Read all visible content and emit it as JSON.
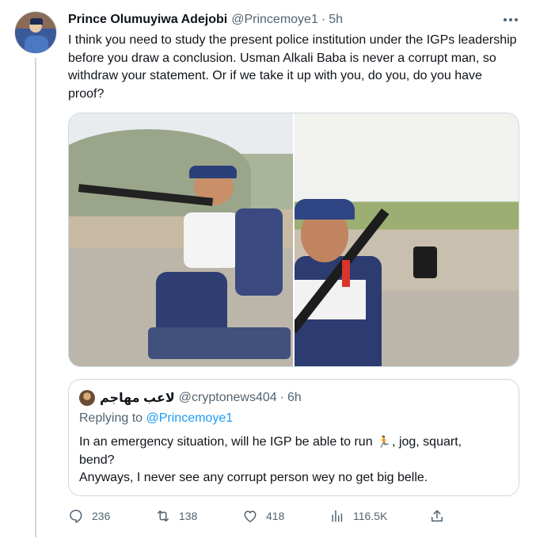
{
  "tweet": {
    "display_name": "Prince Olumuyiwa Adejobi",
    "handle": "@Princemoye1",
    "separator": "·",
    "time": "5h",
    "text": "I think you need to study the present police institution under the IGPs leadership before you draw a conclusion. Usman Alkali Baba is never a corrupt man, so withdraw your statement. Or if we take it up with you, do you, do you have proof?",
    "avatar_icon": "profile-avatar",
    "more_icon": "more-horizontal-icon"
  },
  "media": {
    "photos": [
      {
        "subject": "officer-kneeling-firing-rifle"
      },
      {
        "subject": "officer-holding-rifle"
      }
    ]
  },
  "quote": {
    "display_name": "لاعب مهاجم",
    "handle": "@cryptonews404",
    "separator": "·",
    "time": "6h",
    "replying_prefix": "Replying to",
    "replying_mention": "@Princemoye1",
    "text_line1_before": "In an emergency situation, will he IGP be able to run",
    "text_line1_emoji": "🏃",
    "text_line1_after": ",  jog, squart,",
    "text_line2": "bend?",
    "text_line3": "Anyways, I never see any corrupt person wey no get big belle."
  },
  "actions": {
    "reply_count": "236",
    "retweet_count": "138",
    "like_count": "418",
    "views_count": "116.5K",
    "icons": [
      "reply-icon",
      "retweet-icon",
      "like-icon",
      "views-icon",
      "share-icon"
    ]
  },
  "colors": {
    "text_primary": "#0f1419",
    "text_secondary": "#536471",
    "link": "#1d9bf0",
    "border": "#cfd9de"
  }
}
